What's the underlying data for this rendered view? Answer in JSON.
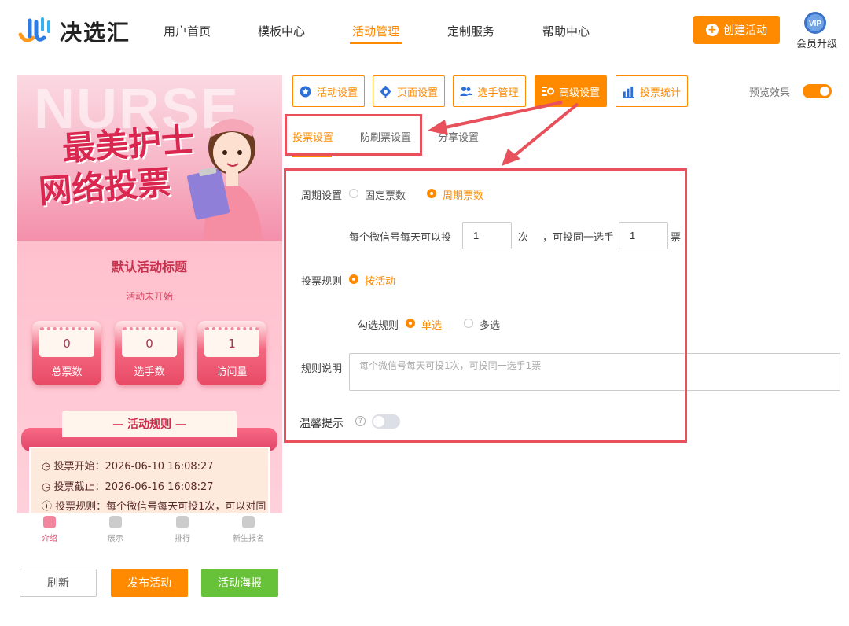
{
  "header": {
    "brand": "决选汇",
    "nav": [
      "用户首页",
      "模板中心",
      "活动管理",
      "定制服务",
      "帮助中心"
    ],
    "active_nav": "活动管理",
    "create_label": "创建活动",
    "vip_text": "VIP",
    "member_upgrade": "会员升级"
  },
  "colors": {
    "accent": "#ff8a00",
    "annotation": "#e8505b",
    "green": "#67c23a"
  },
  "preview": {
    "banner_bg_text": "NURSE",
    "banner_title_line1": "最美护士",
    "banner_title_line2": "网络投票",
    "activity_title": "默认活动标题",
    "status": "活动未开始",
    "stats": [
      {
        "value": "0",
        "label": "总票数"
      },
      {
        "value": "0",
        "label": "选手数"
      },
      {
        "value": "1",
        "label": "访问量"
      }
    ],
    "rules_heading": "— 活动规则 —",
    "rule_lines": [
      "投票开始：2026-06-10 16:08:27",
      "投票截止：2026-06-16 16:08:27",
      "投票规则：每个微信号每天可投1次，可以对同"
    ],
    "tabbar": [
      "介绍",
      "展示",
      "排行",
      "新生报名"
    ]
  },
  "bottom_buttons": {
    "refresh": "刷新",
    "publish": "发布活动",
    "poster": "活动海报"
  },
  "toolbar": {
    "tabs": [
      "活动设置",
      "页面设置",
      "选手管理",
      "高级设置",
      "投票统计"
    ],
    "active": "高级设置",
    "preview_label": "预览效果",
    "preview_on": true
  },
  "sub_tabs": {
    "items": [
      "投票设置",
      "防刷票设置",
      "分享设置"
    ],
    "active": "投票设置"
  },
  "form": {
    "period_label": "周期设置",
    "period_options": [
      "固定票数",
      "周期票数"
    ],
    "period_selected": "周期票数",
    "per_day_prefix": "每个微信号每天可以投",
    "per_day_value": "1",
    "per_day_unit": "次",
    "same_player_prefix": "，可投同一选手",
    "same_player_value": "1",
    "same_player_unit": "票",
    "vote_rule_label": "投票规则",
    "vote_rule_option": "按活动",
    "check_rule_label": "勾选规则",
    "check_options": [
      "单选",
      "多选"
    ],
    "check_selected": "单选",
    "rule_desc_label": "规则说明",
    "rule_desc_placeholder": "每个微信号每天可投1次，可投同一选手1票",
    "tip_label": "温馨提示",
    "tip_enabled": false
  }
}
